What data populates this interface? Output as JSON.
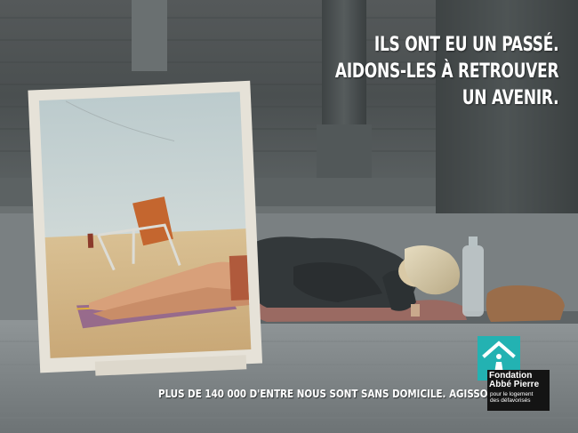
{
  "headline": {
    "line1": "ILS ONT EU UN PASSÉ.",
    "line2": "AIDONS-LES À RETROUVER",
    "line3": "UN AVENIR."
  },
  "tagline": "PLUS DE 140 000 D'ENTRE NOUS SONT SANS DOMICILE. AGISSONS !",
  "logo": {
    "name_line1": "Fondation",
    "name_line2": "Abbé Pierre",
    "sub_line1": "pour le logement",
    "sub_line2": "des défavorisés",
    "color": "#23b2b2"
  },
  "colors": {
    "pavement": "#8e9496",
    "wall": "#4b5254",
    "photo_sky": "#c9d6d8",
    "photo_sand": "#d8bd8f"
  }
}
